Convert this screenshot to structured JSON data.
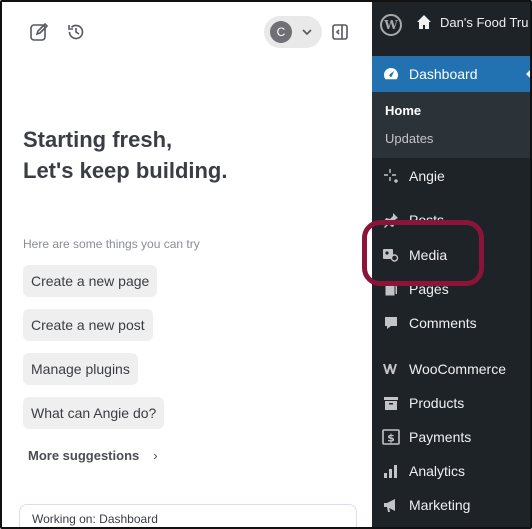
{
  "angie": {
    "avatar_initial": "C",
    "hero_line1": "Starting fresh,",
    "hero_line2": "Let's keep building.",
    "hint": "Here are some things you can try",
    "suggestions": [
      "Create a new page",
      "Create a new post",
      "Manage plugins",
      "What can Angie do?"
    ],
    "more_label": "More suggestions",
    "working_prefix": "Working on: ",
    "working_value": "Dashboard"
  },
  "wp": {
    "site_name": "Dan's Food Tru",
    "dashboard_label": "Dashboard",
    "submenu": [
      "Home",
      "Updates"
    ],
    "menu": [
      {
        "label": "Angie",
        "icon": "sparkle-icon"
      },
      {
        "label": "Posts",
        "icon": "pin-icon"
      },
      {
        "label": "Media",
        "icon": "media-icon"
      },
      {
        "label": "Pages",
        "icon": "pages-icon"
      },
      {
        "label": "Comments",
        "icon": "comment-icon"
      },
      {
        "label": "WooCommerce",
        "icon": "woocommerce-icon"
      },
      {
        "label": "Products",
        "icon": "archive-icon"
      },
      {
        "label": "Payments",
        "icon": "dollar-icon"
      },
      {
        "label": "Analytics",
        "icon": "bar-chart-icon"
      },
      {
        "label": "Marketing",
        "icon": "megaphone-icon"
      }
    ]
  },
  "colors": {
    "wp_admin_bg": "#1d2327",
    "wp_accent": "#2271b1",
    "highlight_ring": "#8a1538"
  }
}
